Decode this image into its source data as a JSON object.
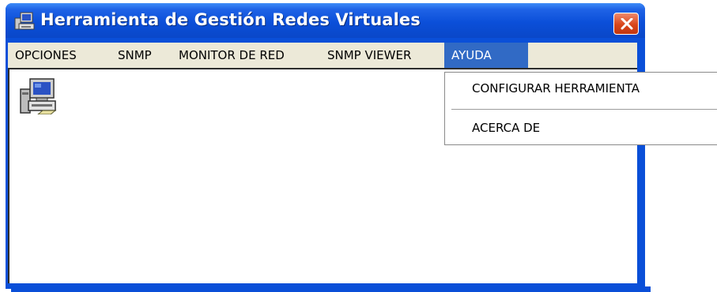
{
  "window": {
    "title": "Herramienta de Gestión Redes Virtuales",
    "app_icon": "network-computer-icon",
    "close_icon": "close-icon",
    "colors": {
      "titlebar": "#0a4fd8",
      "close": "#d9461c",
      "menubar": "#ece9d8",
      "highlight": "#316ac5"
    }
  },
  "menubar": {
    "items": [
      {
        "label": "OPCIONES"
      },
      {
        "label": "SNMP"
      },
      {
        "label": "MONITOR DE RED"
      },
      {
        "label": "SNMP VIEWER"
      },
      {
        "label": "AYUDA",
        "active": true
      }
    ]
  },
  "dropdown": {
    "items": [
      {
        "label": "CONFIGURAR HERRAMIENTA"
      },
      {
        "label": "ACERCA DE"
      }
    ]
  },
  "client": {
    "icon": "network-computer-icon"
  }
}
